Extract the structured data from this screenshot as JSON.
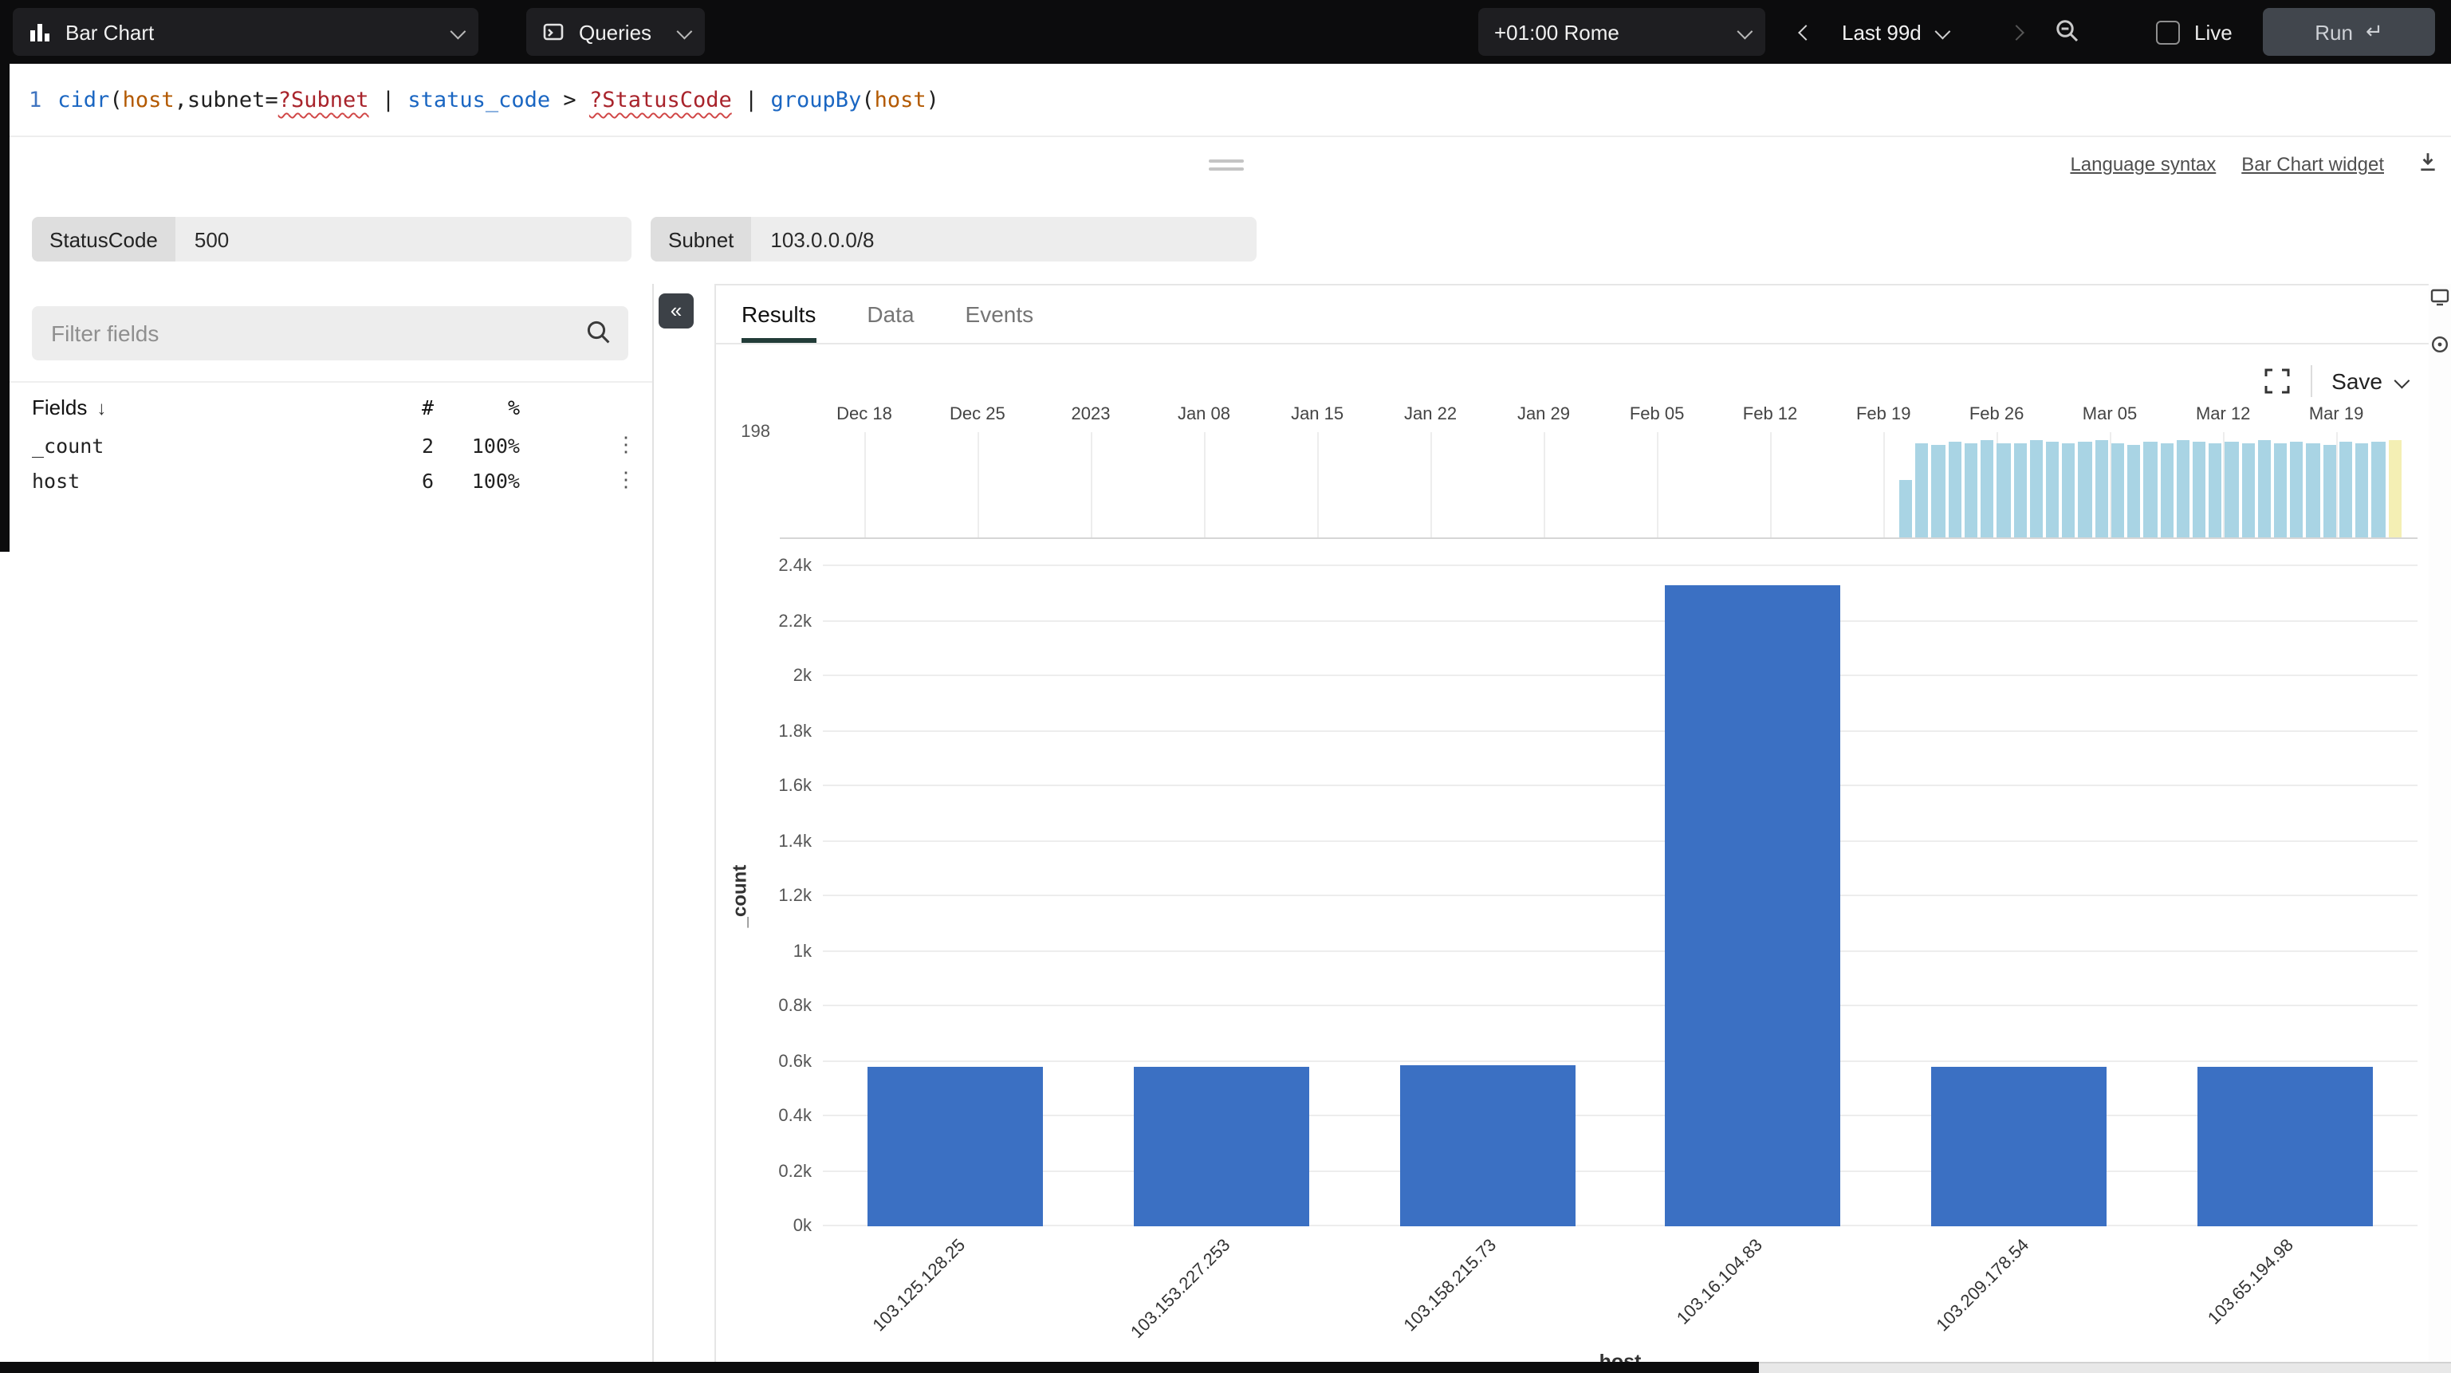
{
  "topbar": {
    "widget_selector_label": "Bar Chart",
    "queries_label": "Queries",
    "timezone_label": "+01:00 Rome",
    "time_range_label": "Last 99d",
    "live_label": "Live",
    "run_label": "Run",
    "run_icon": "↵"
  },
  "editor": {
    "tokens": [
      {
        "text": "1",
        "type": "linenum"
      },
      {
        "text": "cidr",
        "type": "function"
      },
      {
        "text": "(",
        "type": "plain"
      },
      {
        "text": "host",
        "type": "field"
      },
      {
        "text": ",",
        "type": "plain"
      },
      {
        "text": "subnet",
        "type": "plain"
      },
      {
        "text": "=",
        "type": "plain"
      },
      {
        "text": "?Subnet",
        "type": "parameter"
      },
      {
        "text": " | ",
        "type": "plain"
      },
      {
        "text": "status_code",
        "type": "function"
      },
      {
        "text": " > ",
        "type": "plain"
      },
      {
        "text": "?StatusCode",
        "type": "parameter"
      },
      {
        "text": " | ",
        "type": "plain"
      },
      {
        "text": "groupBy",
        "type": "function"
      },
      {
        "text": "(",
        "type": "plain"
      },
      {
        "text": "host",
        "type": "field"
      },
      {
        "text": ")",
        "type": "plain"
      }
    ],
    "links": [
      "Language syntax",
      "Bar Chart widget"
    ]
  },
  "parameters": [
    {
      "label": "StatusCode",
      "value": "500"
    },
    {
      "label": "Subnet",
      "value": "103.0.0.0/8"
    }
  ],
  "fields_panel": {
    "filter_placeholder": "Filter fields",
    "header": {
      "name": "Fields",
      "count": "#",
      "percent": "%"
    },
    "rows": [
      {
        "name": "_count",
        "count": "2",
        "percent": "100%"
      },
      {
        "name": "host",
        "count": "6",
        "percent": "100%"
      }
    ]
  },
  "tabs": [
    {
      "label": "Results",
      "active": true
    },
    {
      "label": "Data",
      "active": false
    },
    {
      "label": "Events",
      "active": false
    }
  ],
  "toolbar": {
    "save_label": "Save"
  },
  "chart_data": [
    {
      "type": "bar",
      "name": "event-distribution-timeline",
      "ylabel_max": "198",
      "ymax": 198,
      "x_ticks": [
        "Dec 18",
        "Dec 25",
        "2023",
        "Jan 08",
        "Jan 15",
        "Jan 22",
        "Jan 29",
        "Feb 05",
        "Feb 12",
        "Feb 19",
        "Feb 26",
        "Mar 05",
        "Mar 12",
        "Mar 19"
      ],
      "values": [
        115,
        190,
        186,
        193,
        189,
        195,
        190,
        187,
        194,
        191,
        188,
        193,
        196,
        190,
        185,
        192,
        189,
        194,
        191,
        187,
        193,
        190,
        195,
        188,
        192,
        190,
        186,
        193,
        189,
        191,
        194
      ],
      "bar_color": "#a9d4e4",
      "current_bar_color": "#f4efb4",
      "legend_position": "none",
      "grid": true
    },
    {
      "type": "bar",
      "name": "groupby-host-results",
      "categories": [
        "103.125.128.25",
        "103.153.227.253",
        "103.158.215.73",
        "103.16.104.83",
        "103.209.178.54",
        "103.65.194.98"
      ],
      "values": [
        580,
        579,
        583,
        2331,
        581,
        578
      ],
      "title": "",
      "xlabel": "host",
      "ylabel": "_count",
      "ylim": [
        0,
        2400
      ],
      "ytick_labels": [
        "0k",
        "0.2k",
        "0.4k",
        "0.6k",
        "0.8k",
        "1k",
        "1.2k",
        "1.4k",
        "1.6k",
        "1.8k",
        "2k",
        "2.2k",
        "2.4k"
      ],
      "bar_color": "#3b70c3",
      "grid": true,
      "legend_position": "none"
    }
  ]
}
